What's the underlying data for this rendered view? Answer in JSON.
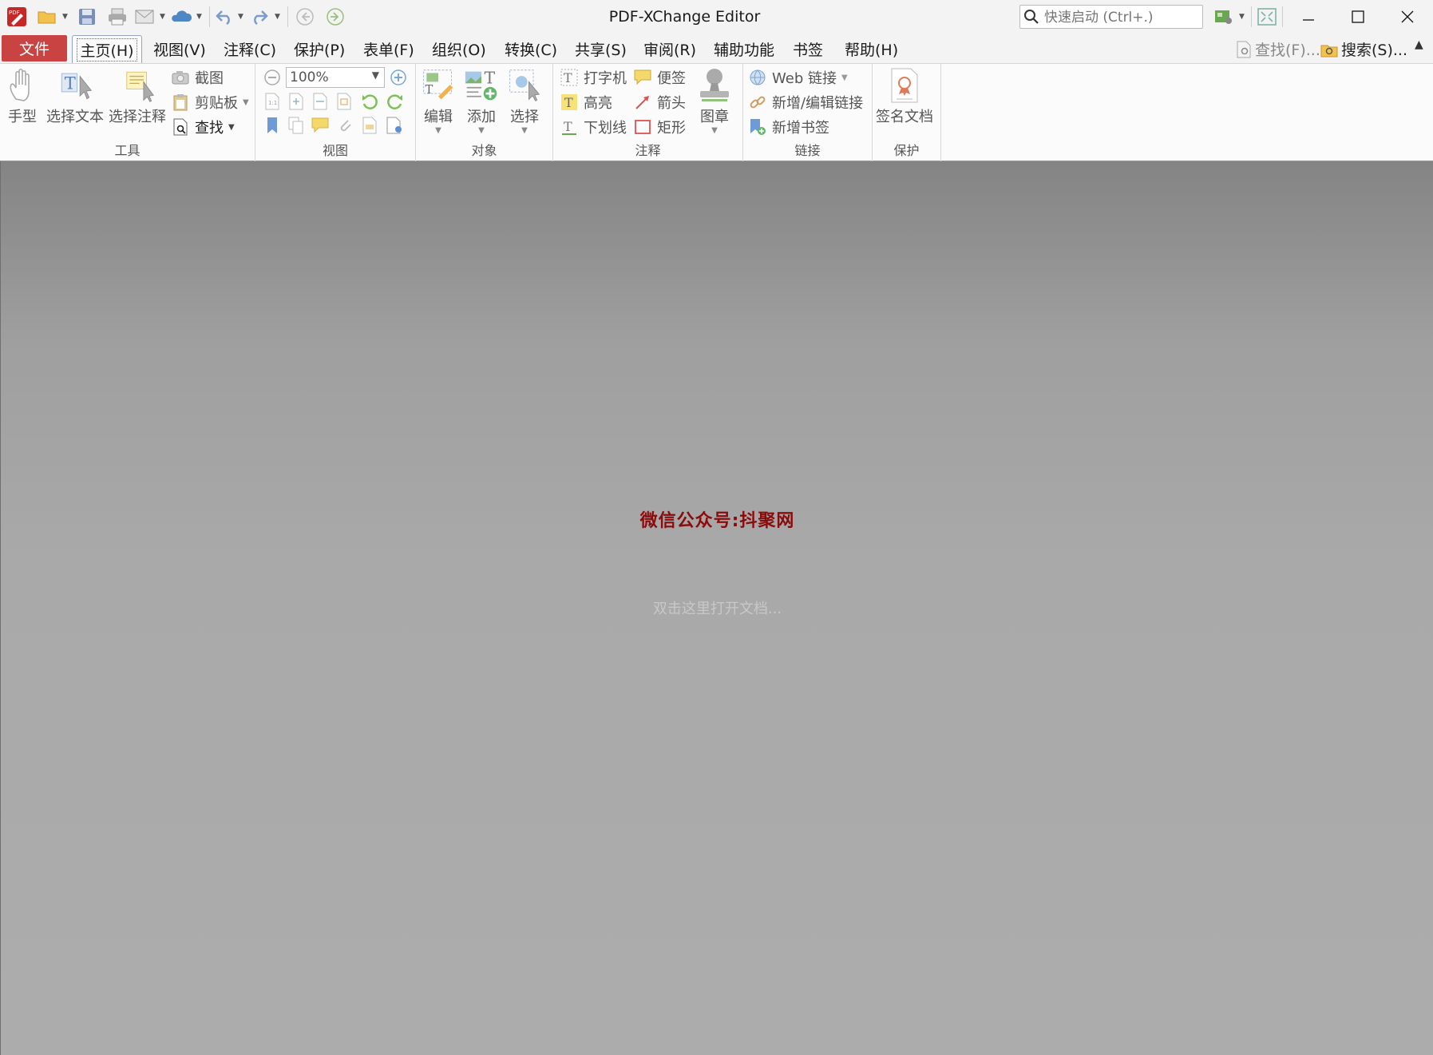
{
  "titlebar": {
    "title": "PDF-XChange Editor",
    "quick_launch_placeholder": "快速启动 (Ctrl+.)",
    "icons": [
      "app-logo-icon",
      "open-folder-icon",
      "save-icon",
      "print-icon",
      "email-icon",
      "cloud-icon",
      "undo-icon",
      "redo-icon",
      "back-icon",
      "forward-icon"
    ],
    "window_controls": [
      "minimize",
      "maximize",
      "close"
    ]
  },
  "menubar": {
    "file": "文件",
    "items": [
      "主页(H)",
      "视图(V)",
      "注释(C)",
      "保护(P)",
      "表单(F)",
      "组织(O)",
      "转换(C)",
      "共享(S)",
      "审阅(R)",
      "辅助功能",
      "书签",
      "帮助(H)"
    ],
    "find": "查找(F)...",
    "search": "搜索(S)..."
  },
  "ribbon": {
    "tools": {
      "label": "工具",
      "hand": "手型",
      "select_text": "选择文本",
      "select_comment": "选择注释",
      "snapshot": "截图",
      "clipboard": "剪贴板",
      "find": "查找"
    },
    "view": {
      "label": "视图",
      "zoom": "100%"
    },
    "objects": {
      "label": "对象",
      "edit": "编辑",
      "add": "添加",
      "select": "选择"
    },
    "comment": {
      "label": "注释",
      "typewriter": "打字机",
      "sticky": "便签",
      "highlight": "高亮",
      "arrow": "箭头",
      "underline": "下划线",
      "rectangle": "矩形",
      "stamp": "图章"
    },
    "links": {
      "label": "链接",
      "web": "Web 链接",
      "add_edit_link": "新增/编辑链接",
      "add_bookmark": "新增书签"
    },
    "protect": {
      "label": "保护",
      "sign": "签名文档"
    }
  },
  "workspace": {
    "watermark": "微信公众号:抖聚网",
    "open_hint": "双击这里打开文档..."
  },
  "colors": {
    "file_tab": "#c94343",
    "watermark": "#8a0b0b"
  }
}
